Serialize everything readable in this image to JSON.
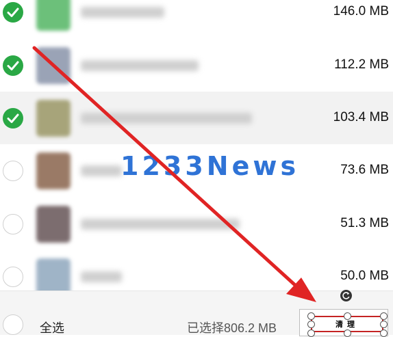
{
  "items": [
    {
      "size": "146.0 MB",
      "checked": true,
      "highlight": false,
      "thumb_color": "#6cc07a"
    },
    {
      "size": "112.2 MB",
      "checked": true,
      "highlight": false,
      "thumb_color": "#9aa3b6"
    },
    {
      "size": "103.4 MB",
      "checked": true,
      "highlight": true,
      "thumb_color": "#a7a47a"
    },
    {
      "size": "73.6 MB",
      "checked": false,
      "highlight": false,
      "thumb_color": "#9a7a66"
    },
    {
      "size": "51.3 MB",
      "checked": false,
      "highlight": false,
      "thumb_color": "#7c6d6f"
    },
    {
      "size": "50.0 MB",
      "checked": false,
      "highlight": false,
      "thumb_color": "#9fb4c7"
    }
  ],
  "footer": {
    "select_all_label": "全选",
    "selected_info": "已选择806.2 MB",
    "clean_button_label": "清理",
    "select_all_checked": false
  },
  "watermark": {
    "text": "1233News",
    "color": "#2f73d6"
  },
  "annotation": {
    "arrow_color": "#e02424"
  },
  "colors": {
    "check_green": "#2aa845",
    "highlight_row": "#f2f2f2"
  }
}
